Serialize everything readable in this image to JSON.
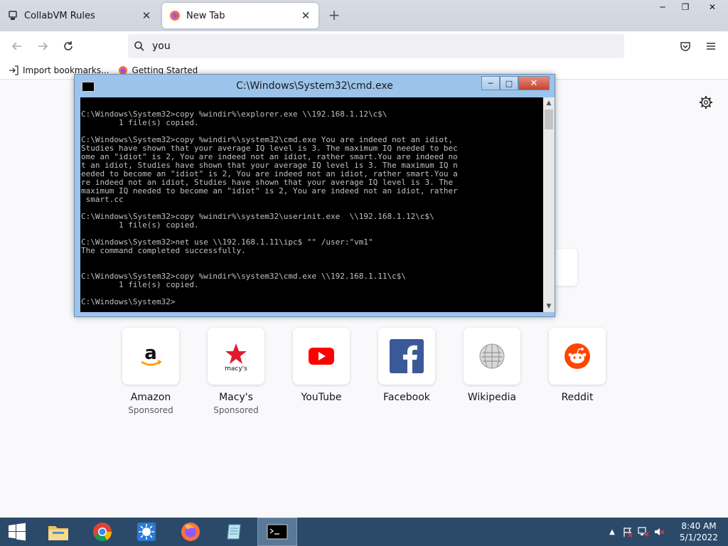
{
  "browser": {
    "tabs": [
      {
        "label": "CollabVM Rules",
        "active": false
      },
      {
        "label": "New Tab",
        "active": true
      }
    ],
    "url_value": "you",
    "bookmarks": [
      {
        "label": "Import bookmarks...",
        "icon": "import-icon"
      },
      {
        "label": "Getting Started",
        "icon": "firefox-icon"
      }
    ]
  },
  "cmd": {
    "title": "C:\\Windows\\System32\\cmd.exe",
    "output": "C:\\Windows\\System32>copy %windir%\\explorer.exe \\\\192.168.1.12\\c$\\\n        1 file(s) copied.\n\nC:\\Windows\\System32>copy %windir%\\system32\\cmd.exe You are indeed not an idiot,\nStudies have shown that your average IQ level is 3. The maximum IQ needed to bec\nome an \"idiot\" is 2, You are indeed not an idiot, rather smart.You are indeed no\nt an idiot, Studies have shown that your average IQ level is 3. The maximum IQ n\needed to become an \"idiot\" is 2, You are indeed not an idiot, rather smart.You a\nre indeed not an idiot, Studies have shown that your average IQ level is 3. The\nmaximum IQ needed to become an \"idiot\" is 2, You are indeed not an idiot, rather\n smart.cc\n\nC:\\Windows\\System32>copy %windir%\\system32\\userinit.exe  \\\\192.168.1.12\\c$\\\n        1 file(s) copied.\n\nC:\\Windows\\System32>net use \\\\192.168.1.11\\ipc$ \"\" /user:\"vm1\"\nThe command completed successfully.\n\n\nC:\\Windows\\System32>copy %windir%\\system32\\cmd.exe \\\\192.168.1.11\\c$\\\n        1 file(s) copied.\n\nC:\\Windows\\System32>"
  },
  "shortcuts": [
    {
      "name": "Amazon",
      "sub": "Sponsored",
      "icon": "amazon-icon"
    },
    {
      "name": "Macy's",
      "sub": "Sponsored",
      "icon": "macys-icon",
      "logo_text": "macy's"
    },
    {
      "name": "YouTube",
      "sub": "",
      "icon": "youtube-icon"
    },
    {
      "name": "Facebook",
      "sub": "",
      "icon": "facebook-icon"
    },
    {
      "name": "Wikipedia",
      "sub": "",
      "icon": "wikipedia-icon"
    },
    {
      "name": "Reddit",
      "sub": "",
      "icon": "reddit-icon"
    }
  ],
  "taskbar": {
    "time": "8:40 AM",
    "date": "5/1/2022"
  },
  "colors": {
    "taskbar": "#2b4a6a",
    "cmd_frame": "#9cc4ea",
    "youtube_red": "#ff0000",
    "facebook_blue": "#3b5998",
    "reddit_orange": "#ff4500"
  }
}
